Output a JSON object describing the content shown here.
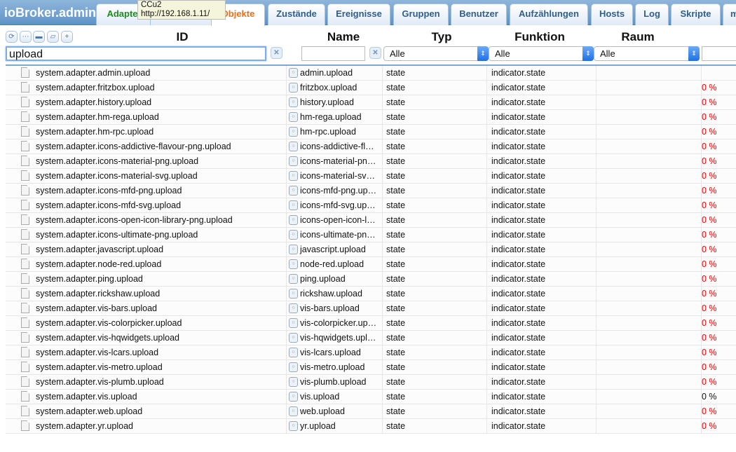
{
  "header": {
    "title": "ioBroker.admin",
    "tooltip_line1": "CCu2",
    "tooltip_line2": "http://192.168.1.11/"
  },
  "tabs": [
    {
      "label": "Adapter"
    },
    {
      "label": ""
    },
    {
      "label": "Objekte"
    },
    {
      "label": "Zustände"
    },
    {
      "label": "Ereignisse"
    },
    {
      "label": "Gruppen"
    },
    {
      "label": "Benutzer"
    },
    {
      "label": "Aufzählungen"
    },
    {
      "label": "Hosts"
    },
    {
      "label": "Log"
    },
    {
      "label": "Skripte"
    },
    {
      "label": "m"
    }
  ],
  "columns": {
    "id": "ID",
    "name": "Name",
    "type": "Typ",
    "function": "Funktion",
    "room": "Raum"
  },
  "filters": {
    "id": "upload",
    "name": "",
    "type": "Alle",
    "function": "Alle",
    "room": "Alle",
    "value": ""
  },
  "rows": [
    {
      "id": "system.adapter.admin.upload",
      "name": "admin.upload",
      "type": "state",
      "function": "indicator.state",
      "value": "",
      "color": "#111"
    },
    {
      "id": "system.adapter.fritzbox.upload",
      "name": "fritzbox.upload",
      "type": "state",
      "function": "indicator.state",
      "value": "0 %",
      "color": "#e00"
    },
    {
      "id": "system.adapter.history.upload",
      "name": "history.upload",
      "type": "state",
      "function": "indicator.state",
      "value": "0 %",
      "color": "#e00"
    },
    {
      "id": "system.adapter.hm-rega.upload",
      "name": "hm-rega.upload",
      "type": "state",
      "function": "indicator.state",
      "value": "0 %",
      "color": "#e00"
    },
    {
      "id": "system.adapter.hm-rpc.upload",
      "name": "hm-rpc.upload",
      "type": "state",
      "function": "indicator.state",
      "value": "0 %",
      "color": "#e00"
    },
    {
      "id": "system.adapter.icons-addictive-flavour-png.upload",
      "name": "icons-addictive-fl…",
      "type": "state",
      "function": "indicator.state",
      "value": "0 %",
      "color": "#e00"
    },
    {
      "id": "system.adapter.icons-material-png.upload",
      "name": "icons-material-pn…",
      "type": "state",
      "function": "indicator.state",
      "value": "0 %",
      "color": "#e00"
    },
    {
      "id": "system.adapter.icons-material-svg.upload",
      "name": "icons-material-sv…",
      "type": "state",
      "function": "indicator.state",
      "value": "0 %",
      "color": "#e00"
    },
    {
      "id": "system.adapter.icons-mfd-png.upload",
      "name": "icons-mfd-png.up…",
      "type": "state",
      "function": "indicator.state",
      "value": "0 %",
      "color": "#e00"
    },
    {
      "id": "system.adapter.icons-mfd-svg.upload",
      "name": "icons-mfd-svg.up…",
      "type": "state",
      "function": "indicator.state",
      "value": "0 %",
      "color": "#e00"
    },
    {
      "id": "system.adapter.icons-open-icon-library-png.upload",
      "name": "icons-open-icon-l…",
      "type": "state",
      "function": "indicator.state",
      "value": "0 %",
      "color": "#e00"
    },
    {
      "id": "system.adapter.icons-ultimate-png.upload",
      "name": "icons-ultimate-pn…",
      "type": "state",
      "function": "indicator.state",
      "value": "0 %",
      "color": "#e00"
    },
    {
      "id": "system.adapter.javascript.upload",
      "name": "javascript.upload",
      "type": "state",
      "function": "indicator.state",
      "value": "0 %",
      "color": "#e00"
    },
    {
      "id": "system.adapter.node-red.upload",
      "name": "node-red.upload",
      "type": "state",
      "function": "indicator.state",
      "value": "0 %",
      "color": "#e00"
    },
    {
      "id": "system.adapter.ping.upload",
      "name": "ping.upload",
      "type": "state",
      "function": "indicator.state",
      "value": "0 %",
      "color": "#e00"
    },
    {
      "id": "system.adapter.rickshaw.upload",
      "name": "rickshaw.upload",
      "type": "state",
      "function": "indicator.state",
      "value": "0 %",
      "color": "#e00"
    },
    {
      "id": "system.adapter.vis-bars.upload",
      "name": "vis-bars.upload",
      "type": "state",
      "function": "indicator.state",
      "value": "0 %",
      "color": "#e00"
    },
    {
      "id": "system.adapter.vis-colorpicker.upload",
      "name": "vis-colorpicker.up…",
      "type": "state",
      "function": "indicator.state",
      "value": "0 %",
      "color": "#e00"
    },
    {
      "id": "system.adapter.vis-hqwidgets.upload",
      "name": "vis-hqwidgets.upl…",
      "type": "state",
      "function": "indicator.state",
      "value": "0 %",
      "color": "#e00"
    },
    {
      "id": "system.adapter.vis-lcars.upload",
      "name": "vis-lcars.upload",
      "type": "state",
      "function": "indicator.state",
      "value": "0 %",
      "color": "#e00"
    },
    {
      "id": "system.adapter.vis-metro.upload",
      "name": "vis-metro.upload",
      "type": "state",
      "function": "indicator.state",
      "value": "0 %",
      "color": "#e00"
    },
    {
      "id": "system.adapter.vis-plumb.upload",
      "name": "vis-plumb.upload",
      "type": "state",
      "function": "indicator.state",
      "value": "0 %",
      "color": "#e00"
    },
    {
      "id": "system.adapter.vis.upload",
      "name": "vis.upload",
      "type": "state",
      "function": "indicator.state",
      "value": "0 %",
      "color": "#111"
    },
    {
      "id": "system.adapter.web.upload",
      "name": "web.upload",
      "type": "state",
      "function": "indicator.state",
      "value": "0 %",
      "color": "#e00"
    },
    {
      "id": "system.adapter.yr.upload",
      "name": "yr.upload",
      "type": "state",
      "function": "indicator.state",
      "value": "0 %",
      "color": "#e00"
    }
  ]
}
